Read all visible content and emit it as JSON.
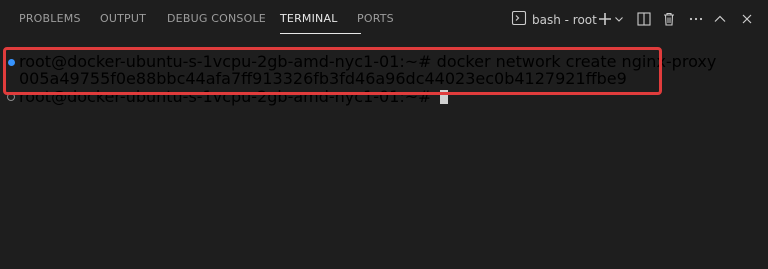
{
  "tabs": [
    {
      "label": "PROBLEMS"
    },
    {
      "label": "OUTPUT"
    },
    {
      "label": "DEBUG CONSOLE"
    },
    {
      "label": "TERMINAL",
      "active": true
    },
    {
      "label": "PORTS"
    }
  ],
  "actions": {
    "terminal_selector_label": "bash - root",
    "icons": [
      "terminal-icon",
      "plus-icon",
      "chevron-down-icon",
      "split-editor-icon",
      "trash-icon",
      "ellipsis-icon",
      "chevron-up-icon",
      "close-icon"
    ]
  },
  "terminal": {
    "lines": [
      {
        "text": "root@docker-ubuntu-s-1vcpu-2gb-amd-nyc1-01:~# docker network create nginx-proxy"
      },
      {
        "text": "005a49755f0e88bbc44afa7ff913326fb3fd46a96dc44023ec0b4127921ffbe9"
      },
      {
        "text": "root@docker-ubuntu-s-1vcpu-2gb-amd-nyc1-01:~#"
      }
    ]
  },
  "colors": {
    "background": "#1e1e1e",
    "highlight_border": "#e03c3c",
    "decoration_success": "#3794ff"
  }
}
